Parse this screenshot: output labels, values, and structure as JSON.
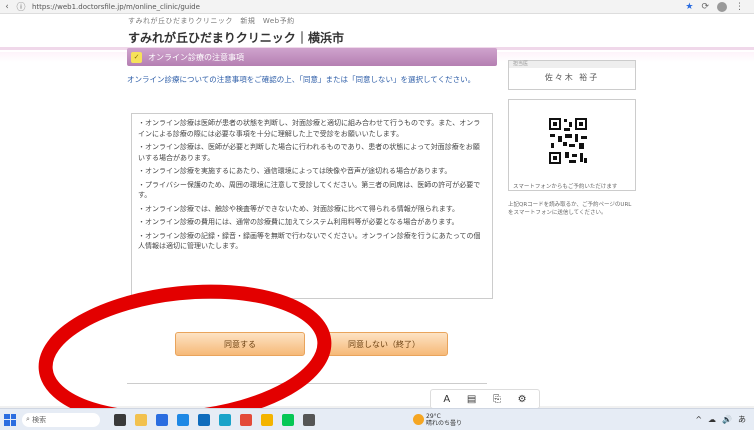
{
  "browser": {
    "url": "https://web1.doctorsfile.jp/m/online_clinic/guide",
    "back_icon": "back-arrow-icon",
    "info_icon": "info-icon",
    "star_icon": "★",
    "sync_icon": "⟳",
    "menu_icon": "⋮"
  },
  "header": {
    "subtitle": "すみれが丘ひだまりクリニック　新規　Web予約",
    "title": "すみれが丘ひだまりクリニック",
    "city": "｜横浜市"
  },
  "section": {
    "label": "オンライン診療の注意事項",
    "lead": "オンライン診療についての注意事項をご確認の上、「同意」または「同意しない」を選択してください。"
  },
  "notice_items": [
    "オンライン診療は医師が患者の状態を判断し、対面診療と適切に組み合わせて行うものです。また、オンラインによる診療の際には必要な事項を十分に理解した上で受診をお願いいたします。",
    "オンライン診療は、医師が必要と判断した場合に行われるものであり、患者の状態によって対面診療をお願いする場合があります。",
    "オンライン診療を実施するにあたり、通信環境によっては映像や音声が途切れる場合があります。",
    "プライバシー保護のため、周囲の環境に注意して受診してください。第三者の同席は、医師の許可が必要です。",
    "オンライン診療では、触診や検査等ができないため、対面診療に比べて得られる情報が限られます。",
    "オンライン診療の費用には、通常の診療費に加えてシステム利用料等が必要となる場合があります。",
    "オンライン診療の記録・録音・録画等を無断で行わないでください。オンライン診療を行うにあたっての個人情報は適切に管理いたします。"
  ],
  "buttons": {
    "agree": "同意する",
    "disagree": "同意しない（終了）"
  },
  "sidebar": {
    "card_header": "担当医",
    "doctor": "佐々木 裕子",
    "qr_caption": "スマートフォンからもご予約いただけます",
    "note": "上記QRコードを読み取るか、ご予約ページのURLをスマートフォンに送信してください。"
  },
  "floatbar": {
    "icons": [
      "A",
      "▤",
      "⎘",
      "⚙"
    ]
  },
  "taskbar": {
    "search": "検索",
    "weather_temp": "29°C",
    "weather_desc": "晴れのち曇り",
    "tray": [
      "^",
      "☁",
      "🔊",
      "あ"
    ]
  },
  "annotation_color": "#e30000"
}
